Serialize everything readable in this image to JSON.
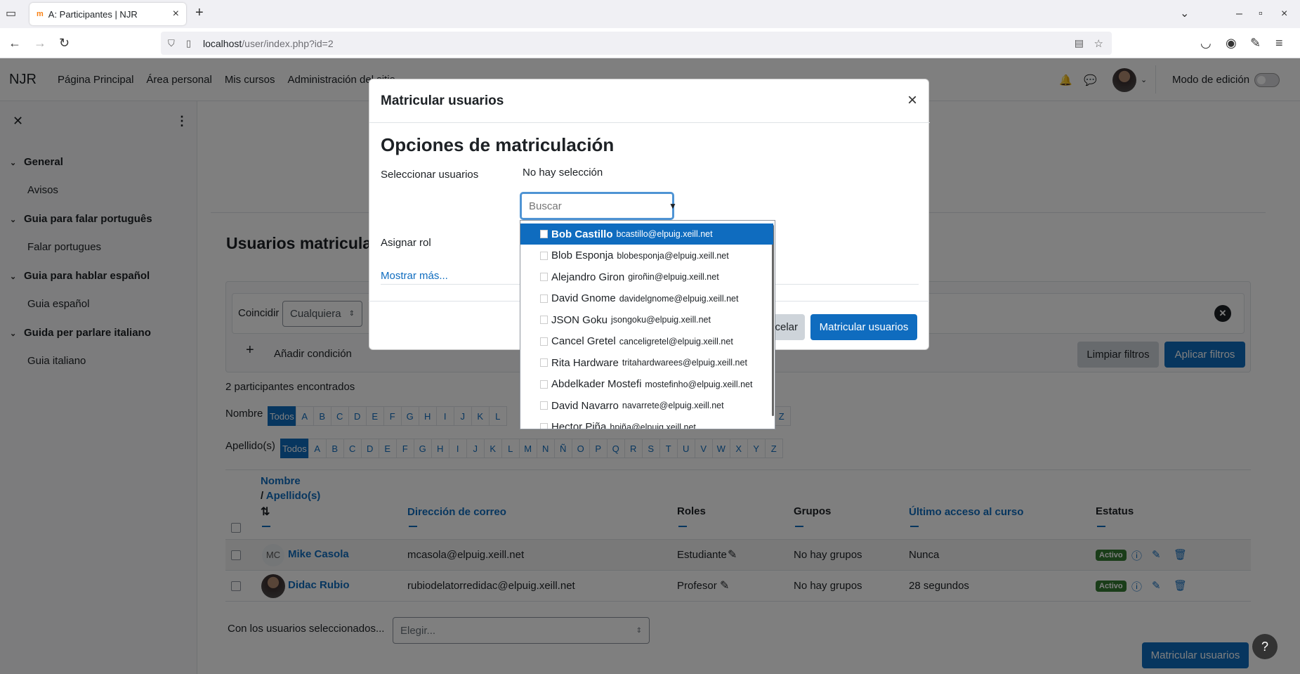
{
  "browser": {
    "tab_title": "A: Participantes | NJR",
    "url_host": "localhost",
    "url_path": "/user/index.php?id=2"
  },
  "nav": {
    "brand": "NJR",
    "links": [
      "Página Principal",
      "Área personal",
      "Mis cursos",
      "Administración del sitio"
    ],
    "edit_mode": "Modo de edición"
  },
  "drawer": {
    "sections": [
      {
        "title": "General",
        "items": [
          "Avisos"
        ]
      },
      {
        "title": "Guia para falar português",
        "items": [
          "Falar portugues"
        ]
      },
      {
        "title": "Guia para hablar español",
        "items": [
          "Guia español"
        ]
      },
      {
        "title": "Guida per parlare italiano",
        "items": [
          "Guia italiano"
        ]
      }
    ]
  },
  "page": {
    "title": "Usuarios matriculados",
    "filter": {
      "match_label": "Coincidir",
      "match_value": "Cualquiera",
      "add_condition": "Añadir condición",
      "clear": "Limpiar filtros",
      "apply": "Aplicar filtros"
    },
    "count": "2 participantes encontrados",
    "name_label": "Nombre",
    "surname_label": "Apellido(s)",
    "all_label": "Todos",
    "letters_first": [
      "A",
      "B",
      "C",
      "D",
      "E",
      "F",
      "G",
      "H",
      "I",
      "J",
      "K",
      "L"
    ],
    "letters_first_tail": [
      "Z"
    ],
    "letters_last": [
      "A",
      "B",
      "C",
      "D",
      "E",
      "F",
      "G",
      "H",
      "I",
      "J",
      "K",
      "L",
      "M",
      "N",
      "Ñ",
      "O",
      "P",
      "Q",
      "R",
      "S",
      "T",
      "U",
      "V",
      "W",
      "X",
      "Y",
      "Z"
    ],
    "table": {
      "col_name": "Nombre",
      "col_surname": "Apellido(s)",
      "col_email": "Dirección de correo",
      "col_roles": "Roles",
      "col_groups": "Grupos",
      "col_access": "Último acceso al curso",
      "col_status": "Estatus",
      "rows": [
        {
          "initials": "MC",
          "name": "Mike Casola",
          "email": "mcasola@elpuig.xeill.net",
          "role": "Estudiante",
          "groups": "No hay grupos",
          "access": "Nunca",
          "status": "Activo"
        },
        {
          "initials": "",
          "name": "Didac Rubio",
          "email": "rubiodelatorredidac@elpuig.xeill.net",
          "role": "Profesor",
          "groups": "No hay grupos",
          "access": "28 segundos",
          "status": "Activo"
        }
      ]
    },
    "bulk_label": "Con los usuarios seleccionados...",
    "bulk_placeholder": "Elegir...",
    "enrol_button": "Matricular usuarios"
  },
  "modal": {
    "title": "Matricular usuarios",
    "heading": "Opciones de matriculación",
    "select_users_label": "Seleccionar usuarios",
    "no_selection": "No hay selección",
    "search_placeholder": "Buscar",
    "assign_role_label": "Asignar rol",
    "show_more": "Mostrar más...",
    "cancel": "Cancelar",
    "cancel_visible": "celar",
    "submit": "Matricular usuarios",
    "suggestions": [
      {
        "name": "Bob Castillo",
        "email": "bcastillo@elpuig.xeill.net"
      },
      {
        "name": "Blob Esponja",
        "email": "blobesponja@elpuig.xeill.net"
      },
      {
        "name": "Alejandro Giron",
        "email": "giroñin@elpuig.xeill.net"
      },
      {
        "name": "David Gnome",
        "email": "davidelgnome@elpuig.xeill.net"
      },
      {
        "name": "JSON Goku",
        "email": "jsongoku@elpuig.xeill.net"
      },
      {
        "name": "Cancel Gretel",
        "email": "canceligretel@elpuig.xeill.net"
      },
      {
        "name": "Rita Hardware",
        "email": "tritahardwarees@elpuig.xeill.net"
      },
      {
        "name": "Abdelkader Mostefi",
        "email": "mostefinho@elpuig.xeill.net"
      },
      {
        "name": "David Navarro",
        "email": "navarrete@elpuig.xeill.net"
      },
      {
        "name": "Hector Piña",
        "email": "hpiña@elpuig.xeill.net"
      }
    ]
  },
  "colors": {
    "primary": "#0f6cbf",
    "success": "#357a32"
  }
}
